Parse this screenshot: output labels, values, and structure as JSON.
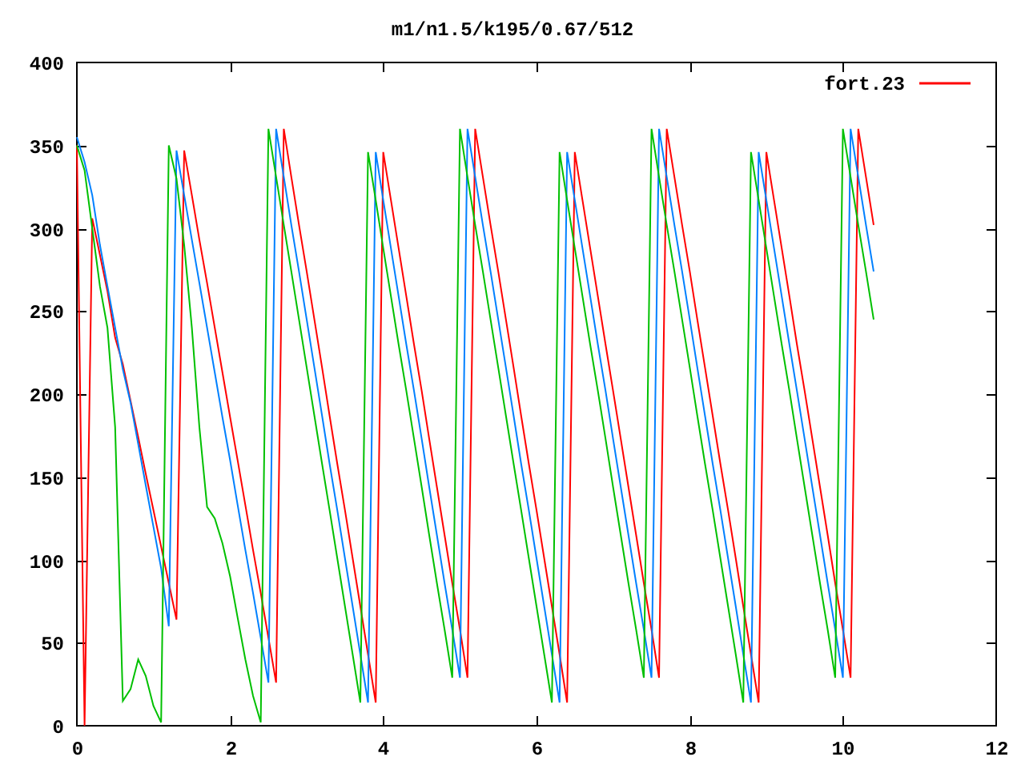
{
  "plot": {
    "chart_data": {
      "type": "line",
      "title": "m1/n1.5/k195/0.67/512",
      "xlim": [
        0,
        12
      ],
      "ylim": [
        0,
        400
      ],
      "xticks": [
        0,
        2,
        4,
        6,
        8,
        10,
        12
      ],
      "yticks": [
        0,
        50,
        100,
        150,
        200,
        250,
        300,
        350,
        400
      ],
      "x": [
        0,
        0.1,
        0.2,
        0.3,
        0.4,
        0.5,
        0.6,
        0.7,
        0.8,
        0.9,
        1,
        1.1,
        1.2,
        1.3,
        1.4,
        1.5,
        1.6,
        1.7,
        1.8,
        1.9,
        2,
        2.1,
        2.2,
        2.3,
        2.4,
        2.5,
        2.6,
        2.7,
        2.8,
        2.9,
        3,
        3.1,
        3.2,
        3.3,
        3.4,
        3.5,
        3.6,
        3.7,
        3.8,
        3.9,
        4,
        4.1,
        4.2,
        4.3,
        4.4,
        4.5,
        4.6,
        4.7,
        4.8,
        4.9,
        5,
        5.1,
        5.2,
        5.3,
        5.4,
        5.5,
        5.6,
        5.7,
        5.8,
        5.9,
        6,
        6.1,
        6.2,
        6.3,
        6.4,
        6.5,
        6.6,
        6.7,
        6.8,
        6.9,
        7,
        7.1,
        7.2,
        7.3,
        7.4,
        7.5,
        7.6,
        7.7,
        7.8,
        7.9,
        8,
        8.1,
        8.2,
        8.3,
        8.4,
        8.5,
        8.6,
        8.7,
        8.8,
        8.9,
        9,
        9.1,
        9.2,
        9.3,
        9.4,
        9.5,
        9.6,
        9.7,
        9.8,
        9.9,
        10,
        10.1,
        10.2,
        10.3,
        10.4
      ],
      "series": [
        {
          "name": "fort.23",
          "color": "#ff0000",
          "values": [
            350,
            0,
            306,
            284,
            262,
            234,
            218,
            196,
            174,
            152,
            130,
            108,
            86,
            64,
            347,
            320,
            293,
            267,
            240,
            213,
            186,
            160,
            133,
            106,
            80,
            53,
            26,
            360,
            331,
            302,
            274,
            245,
            216,
            187,
            158,
            130,
            101,
            72,
            43,
            14,
            346,
            317,
            288,
            259,
            230,
            202,
            173,
            144,
            115,
            86,
            58,
            29,
            360,
            331,
            302,
            274,
            245,
            216,
            187,
            158,
            130,
            101,
            72,
            43,
            14,
            346,
            317,
            288,
            259,
            230,
            202,
            173,
            144,
            115,
            86,
            58,
            29,
            360,
            331,
            302,
            274,
            245,
            216,
            187,
            158,
            130,
            101,
            72,
            43,
            14,
            346,
            317,
            288,
            259,
            230,
            202,
            173,
            144,
            115,
            86,
            58,
            29,
            360,
            331,
            302
          ]
        },
        {
          "color": "#0080ff",
          "values": [
            355,
            340,
            320,
            290,
            265,
            240,
            215,
            195,
            170,
            145,
            120,
            95,
            60,
            347,
            320,
            293,
            267,
            240,
            213,
            186,
            160,
            133,
            106,
            80,
            53,
            26,
            360,
            331,
            302,
            274,
            245,
            216,
            187,
            158,
            130,
            101,
            72,
            43,
            14,
            346,
            317,
            288,
            259,
            230,
            202,
            173,
            144,
            115,
            86,
            58,
            29,
            360,
            331,
            302,
            274,
            245,
            216,
            187,
            158,
            130,
            101,
            72,
            43,
            14,
            346,
            317,
            288,
            259,
            230,
            202,
            173,
            144,
            115,
            86,
            58,
            29,
            360,
            331,
            302,
            274,
            245,
            216,
            187,
            158,
            130,
            101,
            72,
            43,
            14,
            346,
            317,
            288,
            259,
            230,
            202,
            173,
            144,
            115,
            86,
            58,
            29,
            360,
            331,
            302,
            274
          ]
        },
        {
          "color": "#00c000",
          "values": [
            350,
            335,
            300,
            265,
            240,
            180,
            15,
            22,
            40,
            30,
            12,
            2,
            350,
            330,
            290,
            240,
            180,
            132,
            125,
            110,
            90,
            65,
            40,
            18,
            2,
            360,
            331,
            302,
            274,
            245,
            216,
            187,
            158,
            130,
            101,
            72,
            43,
            14,
            346,
            317,
            288,
            259,
            230,
            202,
            173,
            144,
            115,
            86,
            58,
            29,
            360,
            331,
            302,
            274,
            245,
            216,
            187,
            158,
            130,
            101,
            72,
            43,
            14,
            346,
            317,
            288,
            259,
            230,
            202,
            173,
            144,
            115,
            86,
            58,
            29,
            360,
            331,
            302,
            274,
            245,
            216,
            187,
            158,
            130,
            101,
            72,
            43,
            14,
            346,
            317,
            288,
            259,
            230,
            202,
            173,
            144,
            115,
            86,
            58,
            29,
            360,
            331,
            302,
            274,
            245
          ]
        }
      ]
    }
  }
}
